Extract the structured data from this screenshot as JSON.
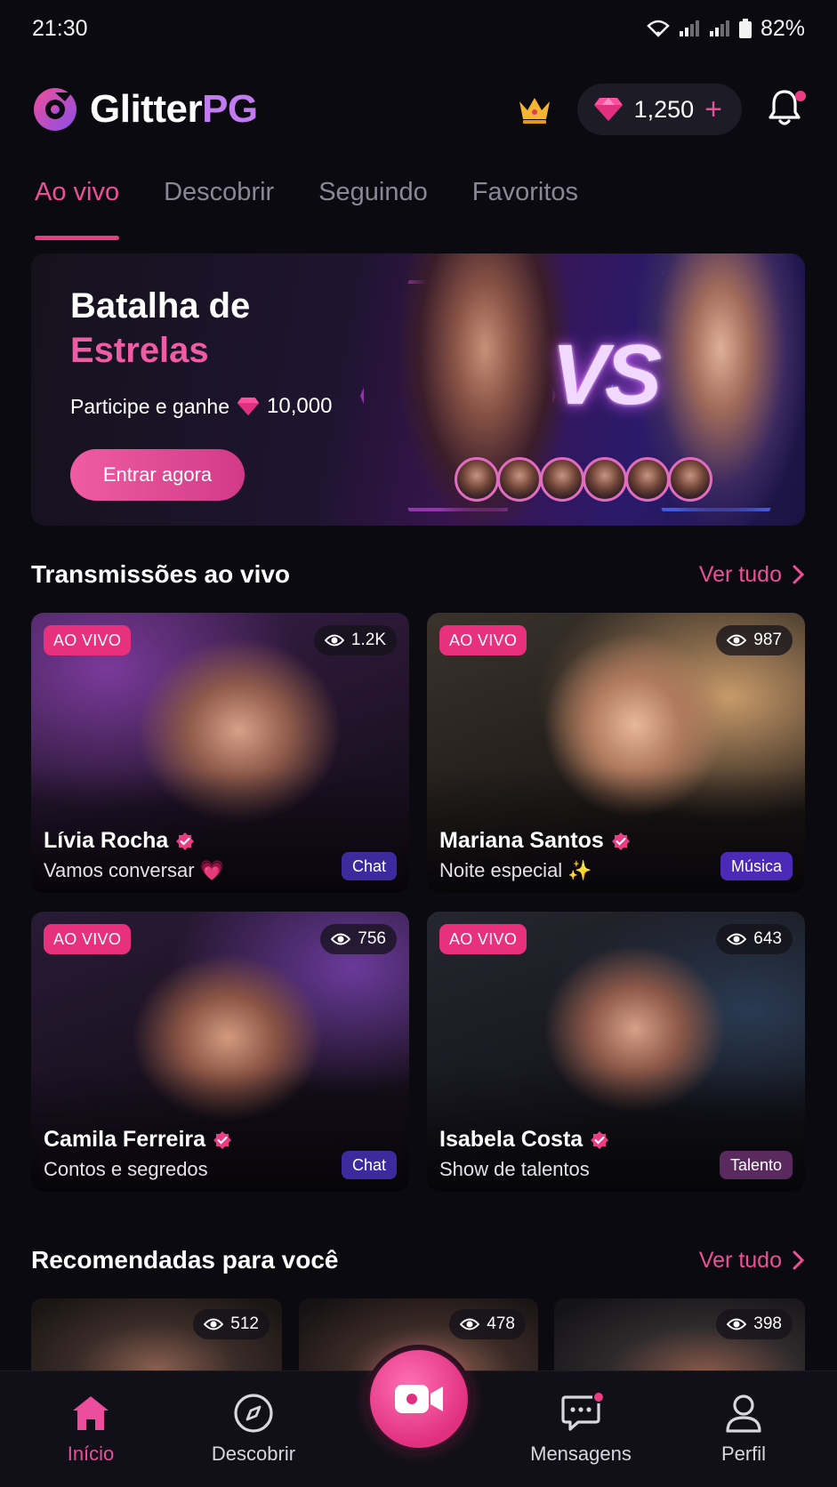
{
  "status_bar": {
    "time": "21:30",
    "battery": "82%"
  },
  "header": {
    "app_name_part1": "Glitter",
    "app_name_part2": "PG",
    "gem_balance": "1,250",
    "add_label": "+",
    "colors": {
      "accent": "#ec3d84",
      "brand_purple": "#c27bf0"
    }
  },
  "tabs": [
    {
      "label": "Ao vivo",
      "active": true
    },
    {
      "label": "Descobrir",
      "active": false
    },
    {
      "label": "Seguindo",
      "active": false
    },
    {
      "label": "Favoritos",
      "active": false
    }
  ],
  "banner": {
    "title_line1": "Batalha de",
    "title_line2": "Estrelas",
    "subtitle": "Participe e ganhe",
    "prize": "10,000",
    "cta": "Entrar agora",
    "vs": "VS"
  },
  "live_section": {
    "title": "Transmissões ao vivo",
    "see_all": "Ver tudo",
    "cards": [
      {
        "badge": "AO VIVO",
        "viewers": "1.2K",
        "name": "Lívia Rocha",
        "subtitle": "Vamos conversar",
        "emoji": "💗",
        "tag": "Chat",
        "tag_color": "#3d2a9c",
        "photo_tint": "#5a2a6e"
      },
      {
        "badge": "AO VIVO",
        "viewers": "987",
        "name": "Mariana Santos",
        "subtitle": "Noite especial",
        "emoji": "✨",
        "tag": "Música",
        "tag_color": "#4b2ab8",
        "photo_tint": "#6e5040"
      },
      {
        "badge": "AO VIVO",
        "viewers": "756",
        "name": "Camila Ferreira",
        "subtitle": "Contos e segredos",
        "emoji": "",
        "tag": "Chat",
        "tag_color": "#3d2a9c",
        "photo_tint": "#3e2450"
      },
      {
        "badge": "AO VIVO",
        "viewers": "643",
        "name": "Isabela Costa",
        "subtitle": "Show de talentos",
        "emoji": "",
        "tag": "Talento",
        "tag_color": "#5a2a5e",
        "photo_tint": "#2a2a3a"
      }
    ]
  },
  "recommended_section": {
    "title": "Recomendadas para você",
    "see_all": "Ver tudo",
    "cards": [
      {
        "viewers": "512"
      },
      {
        "viewers": "478"
      },
      {
        "viewers": "398"
      }
    ]
  },
  "bottom_nav": {
    "items": [
      {
        "label": "Início",
        "icon": "home-icon",
        "active": true
      },
      {
        "label": "Descobrir",
        "icon": "compass-icon",
        "active": false
      },
      {
        "label": "Mensagens",
        "icon": "chat-icon",
        "active": false
      },
      {
        "label": "Perfil",
        "icon": "user-icon",
        "active": false
      }
    ],
    "center_icon": "video-camera-icon"
  }
}
